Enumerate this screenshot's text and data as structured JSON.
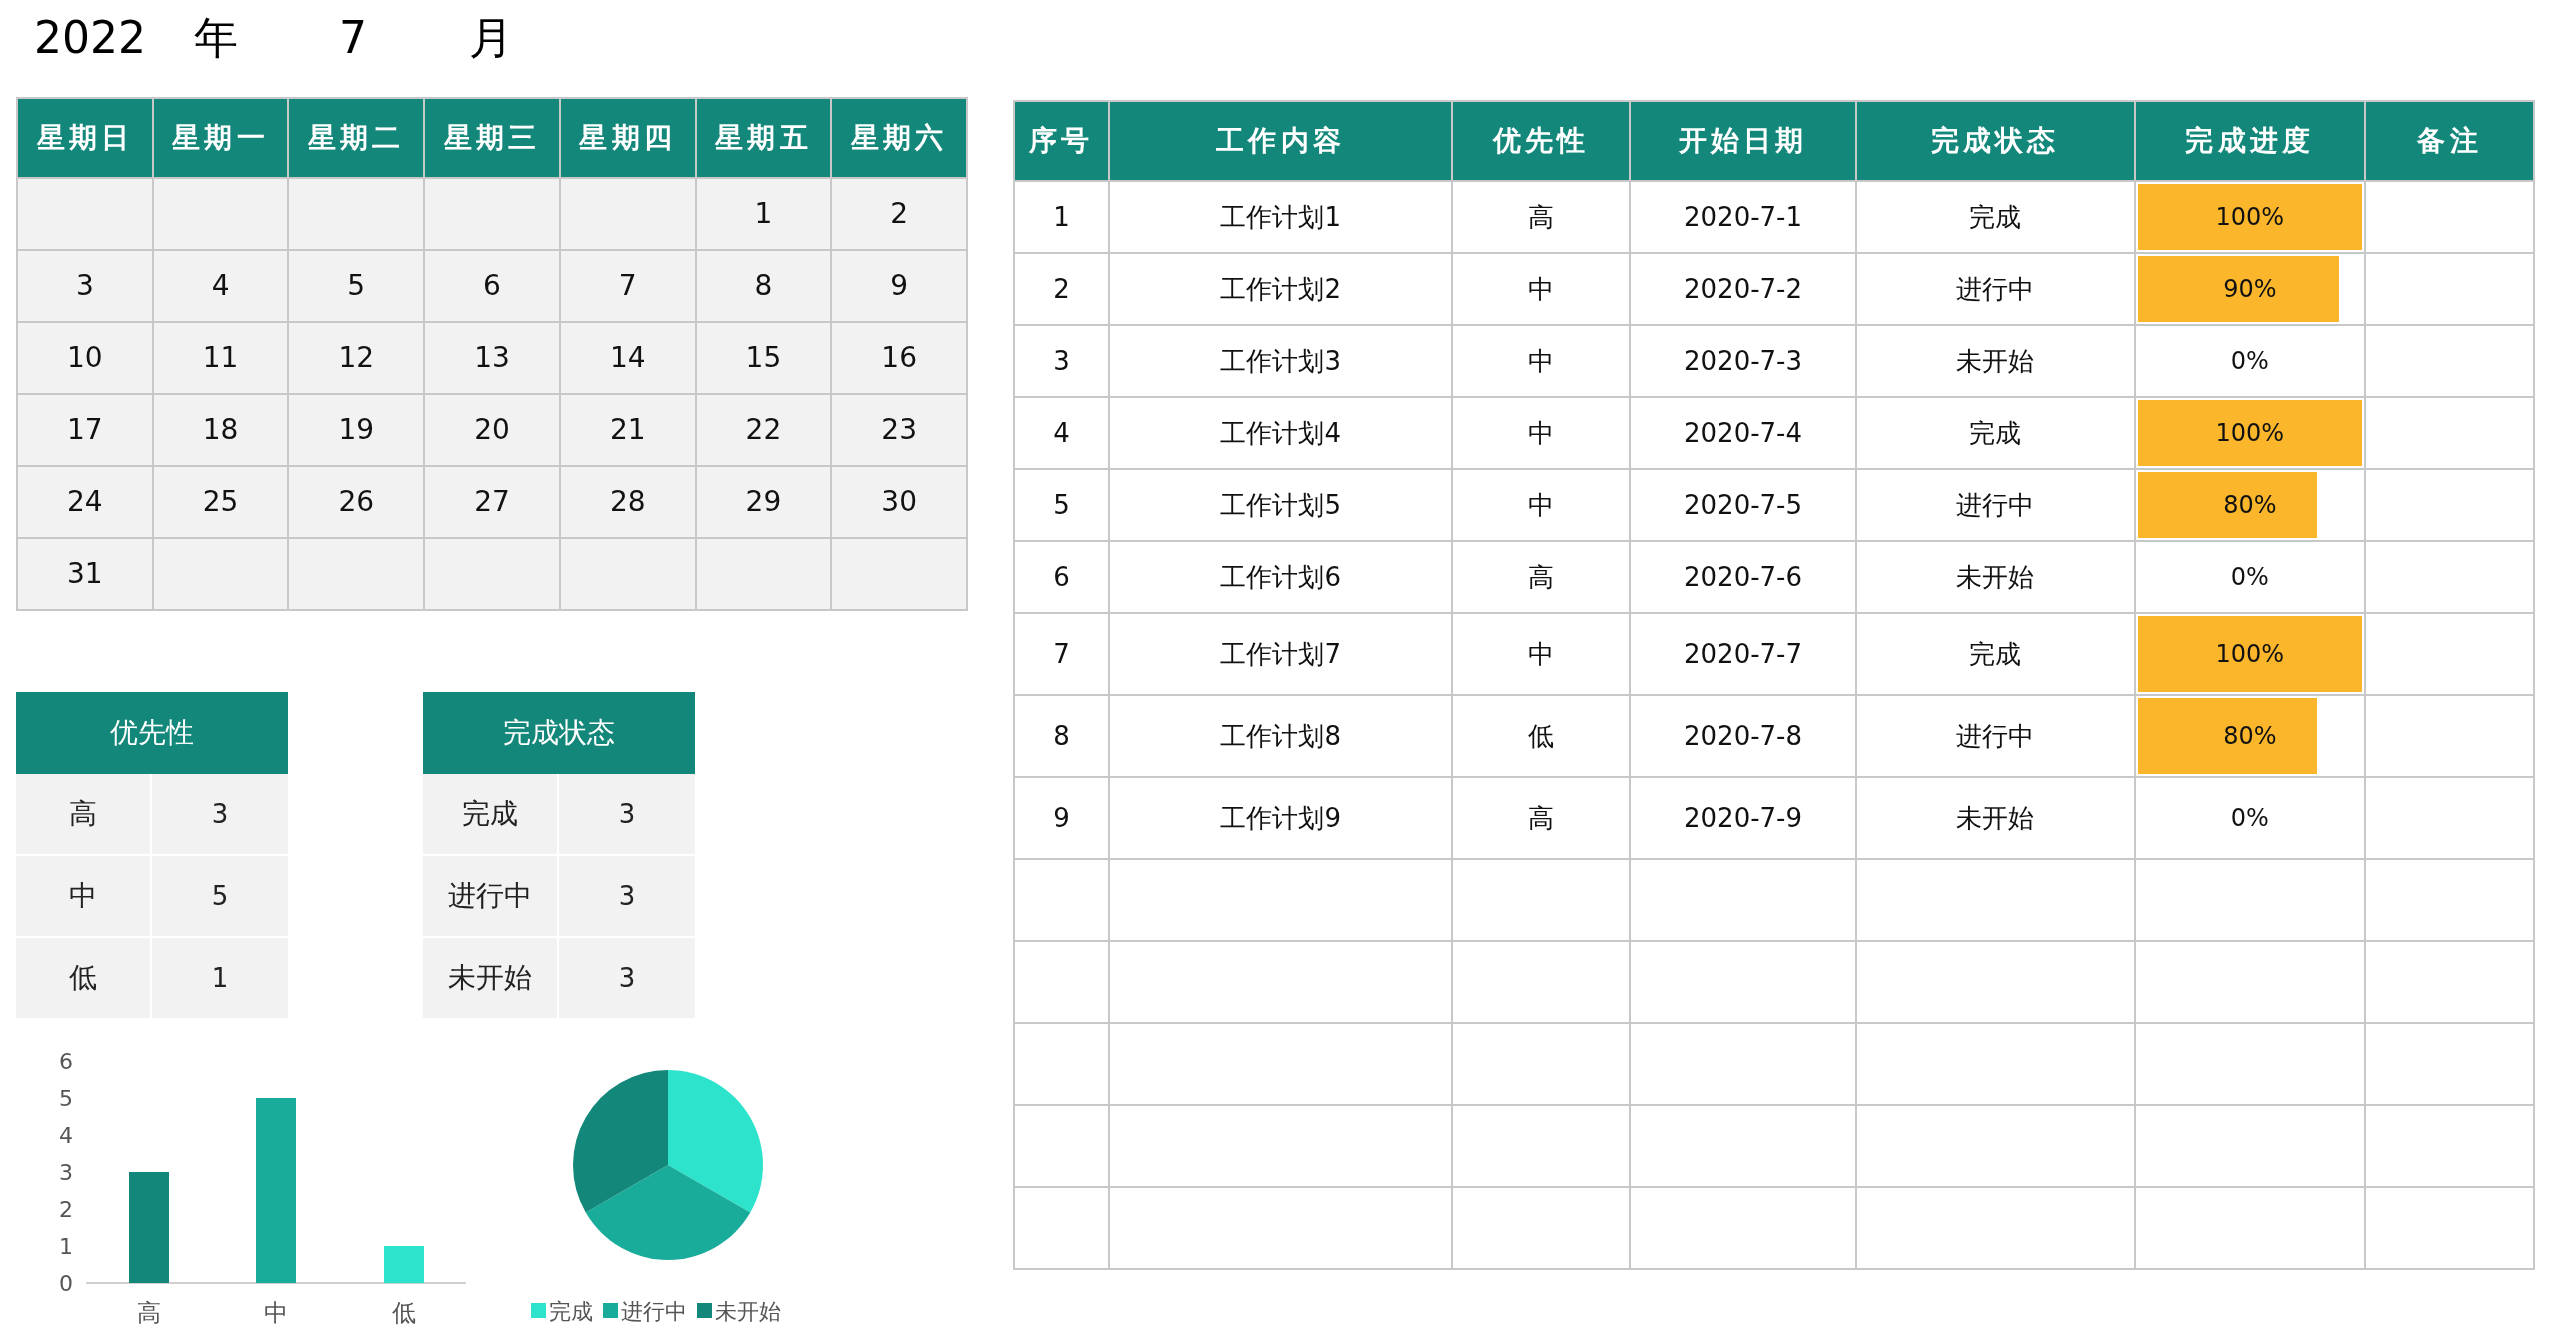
{
  "title": {
    "year": "2022",
    "year_unit": "年",
    "month": "7",
    "month_unit": "月"
  },
  "calendar": {
    "weekdays": [
      "星期日",
      "星期一",
      "星期二",
      "星期三",
      "星期四",
      "星期五",
      "星期六"
    ],
    "weeks": [
      [
        "1",
        "2"
      ],
      [
        "3",
        "4",
        "5",
        "6",
        "7",
        "8",
        "9"
      ],
      [
        "10",
        "11",
        "12",
        "13",
        "14",
        "15",
        "16"
      ],
      [
        "17",
        "18",
        "19",
        "20",
        "21",
        "22",
        "23"
      ],
      [
        "24",
        "25",
        "26",
        "27",
        "28",
        "29",
        "30"
      ],
      [
        "31"
      ]
    ]
  },
  "priority_summary": {
    "header": "优先性",
    "rows": [
      {
        "label": "高",
        "count": "3"
      },
      {
        "label": "中",
        "count": "5"
      },
      {
        "label": "低",
        "count": "1"
      }
    ]
  },
  "status_summary": {
    "header": "完成状态",
    "rows": [
      {
        "label": "完成",
        "count": "3"
      },
      {
        "label": "进行中",
        "count": "3"
      },
      {
        "label": "未开始",
        "count": "3"
      }
    ]
  },
  "priority_chart": {
    "chart_data": {
      "type": "bar",
      "categories": [
        "高",
        "中",
        "低"
      ],
      "colors": [
        "#12877a",
        "#1aac9a",
        "#2ee3cc"
      ],
      "values": [
        3,
        5,
        1
      ],
      "ylim": [
        0,
        6
      ],
      "yticks": [
        0,
        1,
        2,
        3,
        4,
        5,
        6
      ]
    }
  },
  "status_chart": {
    "chart_data": {
      "type": "pie",
      "categories": [
        "完成",
        "进行中",
        "未开始"
      ],
      "colors": [
        "#2ee3cc",
        "#1aac9a",
        "#12877a"
      ],
      "values": [
        33.33,
        33.33,
        33.34
      ],
      "legend": true
    }
  },
  "tasks": {
    "columns": [
      "序号",
      "工作内容",
      "优先性",
      "开始日期",
      "完成状态",
      "完成进度",
      "备注"
    ],
    "rows": [
      {
        "no": "1",
        "content": "工作计划1",
        "priority": "高",
        "start_date": "2020-7-1",
        "status": "完成",
        "progress": {
          "level": 1,
          "reading": "100%"
        }
      },
      {
        "no": "2",
        "content": "工作计划2",
        "priority": "中",
        "start_date": "2020-7-2",
        "status": "进行中",
        "progress": {
          "level": 0.9,
          "reading": "90%"
        }
      },
      {
        "no": "3",
        "content": "工作计划3",
        "priority": "中",
        "start_date": "2020-7-3",
        "status": "未开始",
        "progress": {
          "reading": "0%"
        }
      },
      {
        "no": "4",
        "content": "工作计划4",
        "priority": "中",
        "start_date": "2020-7-4",
        "status": "完成",
        "progress": {
          "level": 1,
          "reading": "100%"
        }
      },
      {
        "no": "5",
        "content": "工作计划5",
        "priority": "中",
        "start_date": "2020-7-5",
        "status": "进行中",
        "progress": {
          "level": 0.8,
          "reading": "80%"
        }
      },
      {
        "no": "6",
        "content": "工作计划6",
        "priority": "高",
        "start_date": "2020-7-6",
        "status": "未开始",
        "progress": {
          "reading": "0%"
        }
      },
      {
        "no": "7",
        "content": "工作计划7",
        "priority": "中",
        "start_date": "2020-7-7",
        "status": "完成",
        "progress": {
          "level": 1,
          "reading": "100%"
        }
      },
      {
        "no": "8",
        "content": "工作计划8",
        "priority": "低",
        "start_date": "2020-7-8",
        "status": "进行中",
        "progress": {
          "level": 0.8,
          "reading": "80%"
        }
      },
      {
        "no": "9",
        "content": "工作计划9",
        "priority": "高",
        "start_date": "2020-7-9",
        "status": "未开始",
        "progress": {
          "reading": "0%"
        }
      }
    ]
  }
}
